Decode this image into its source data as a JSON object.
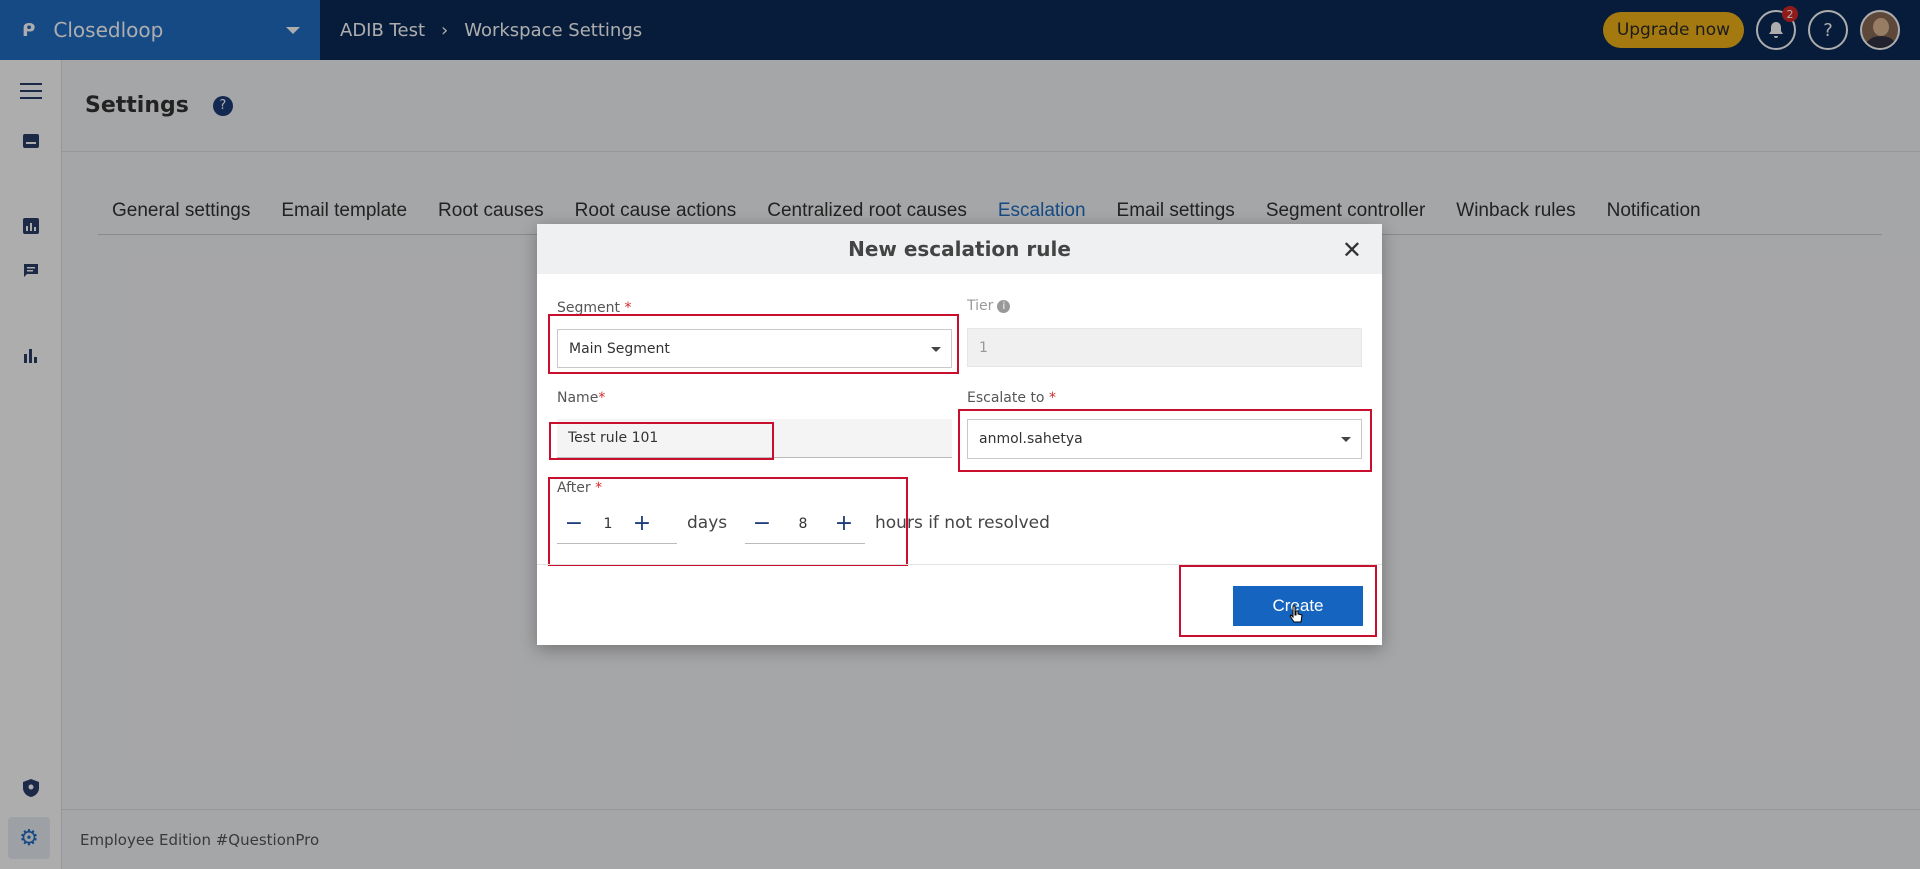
{
  "topbar": {
    "brand_name": "Closedloop",
    "breadcrumbs": [
      "ADIB Test",
      "Workspace Settings"
    ],
    "upgrade_label": "Upgrade now",
    "notification_count": "2",
    "help_label": "?"
  },
  "settings": {
    "title": "Settings",
    "tabs": [
      "General settings",
      "Email template",
      "Root causes",
      "Root cause actions",
      "Centralized root causes",
      "Escalation",
      "Email settings",
      "Segment controller",
      "Winback rules",
      "Notification"
    ],
    "active_tab": "Escalation"
  },
  "footer": {
    "text": "Employee Edition #QuestionPro"
  },
  "modal": {
    "title": "New escalation rule",
    "segment_label": "Segment",
    "segment_value": "Main Segment",
    "tier_label": "Tier",
    "tier_value": "1",
    "name_label": "Name",
    "name_value": "Test rule 101",
    "escalate_label": "Escalate to",
    "escalate_value": "anmol.sahetya",
    "after_label": "After",
    "days_value": "1",
    "days_unit": "days",
    "hours_value": "8",
    "hours_unit": "hours if not resolved",
    "create_label": "Create",
    "required_mark": "*"
  },
  "colors": {
    "accent": "#1f6ec4",
    "navbar": "#0b2a57",
    "highlight": "#c8102e",
    "upgrade": "#f2b418"
  }
}
